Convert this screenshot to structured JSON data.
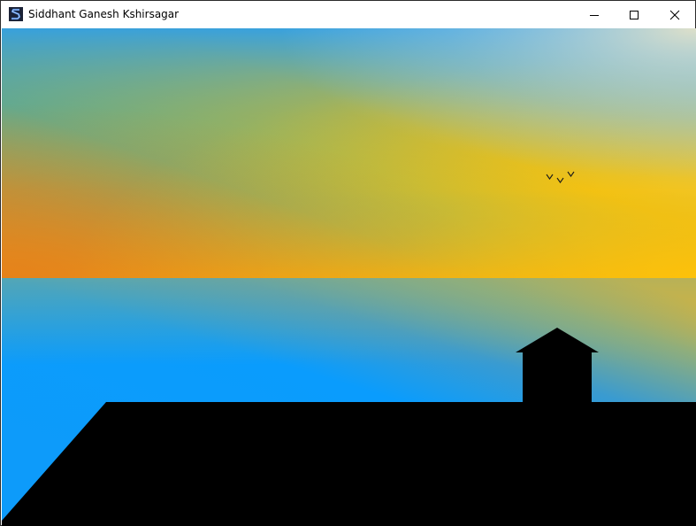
{
  "window": {
    "title": "Siddhant Ganesh Kshirsagar",
    "app_icon": "s-logo-icon",
    "controls": {
      "minimize": "minimize-icon",
      "maximize": "maximize-icon",
      "close": "close-icon"
    }
  },
  "scene": {
    "sky_colors": {
      "sky_blue": "#2f9fe6",
      "teal": "#4da3a6",
      "green": "#7fb070",
      "orange": "#e5801b",
      "amber": "#f5a70f",
      "gold": "#fdc30a",
      "sand": "#e7e3c8",
      "pale_blue": "#9fcbe4"
    },
    "water_colors": {
      "bright_blue": "#0d9bfa",
      "deep_blue": "#0a9cfd",
      "teal": "#3a9bd0",
      "olive": "#8fae7c",
      "amber": "#e9b52b"
    },
    "silhouette_color": "#000000",
    "birds_color": "#1a1a1a"
  }
}
